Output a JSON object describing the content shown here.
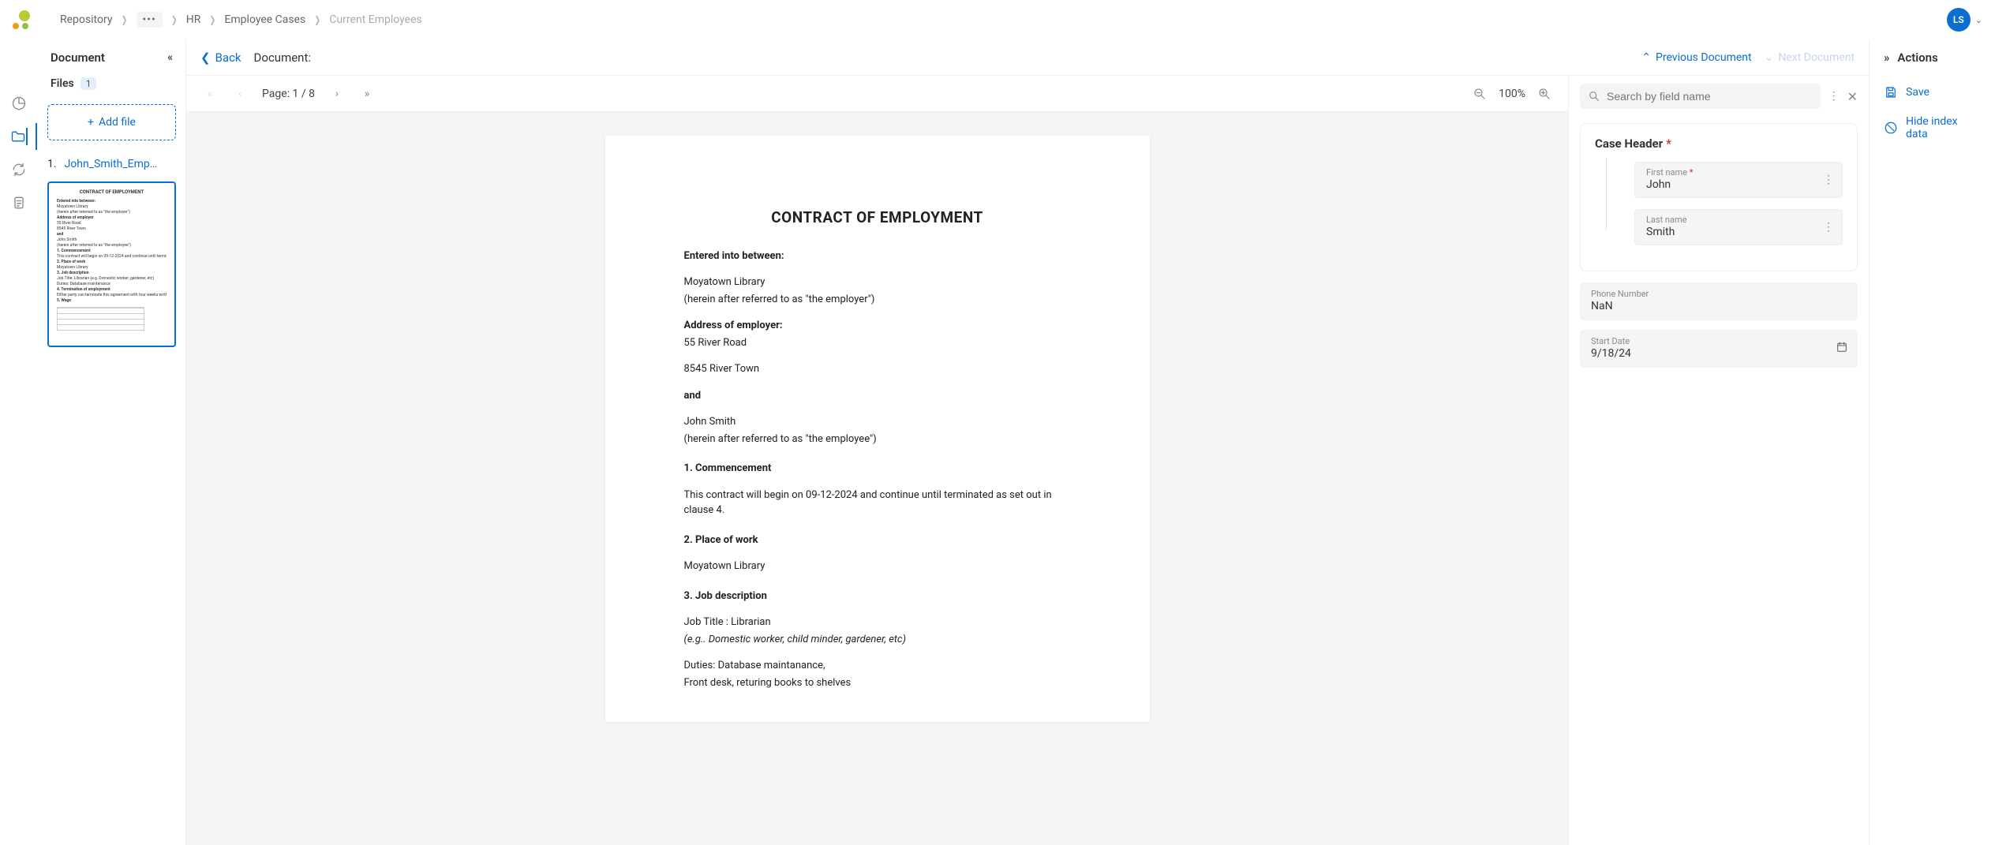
{
  "breadcrumb": {
    "root": "Repository",
    "ellipsis": "•••",
    "hr": "HR",
    "cases": "Employee Cases",
    "current": "Current Employees"
  },
  "user": {
    "initials": "LS"
  },
  "sidebar": {
    "title": "Document",
    "files_label": "Files",
    "files_count": "1",
    "add_file": "Add file",
    "file": {
      "index": "1.",
      "name": "John_Smith_Emp…"
    }
  },
  "docHeader": {
    "back": "Back",
    "label": "Document:",
    "prev": "Previous Document",
    "next": "Next Document"
  },
  "viewerToolbar": {
    "page_label": "Page: 1 / 8",
    "zoom": "100%"
  },
  "page": {
    "title": "CONTRACT OF EMPLOYMENT",
    "entered": "Entered into between:",
    "employer_name": "Moyatown Library",
    "employer_ref": "(herein after referred to as \"the employer\")",
    "addr_label": "Address of employer:",
    "addr1": "55 River Road",
    "addr2": "8545 River Town",
    "and": "and",
    "employee_name": "John Smith",
    "employee_ref": "(herein after referred to as \"the employee\")",
    "s1": "1. Commencement",
    "s1_body": "This contract will begin on 09-12-2024 and continue until terminated as set out in clause 4.",
    "s2": "2. Place of work",
    "s2_body": "Moyatown Library",
    "s3": "3. Job description",
    "s3_title": "Job Title : Librarian",
    "s3_eg": "(e.g.. Domestic worker, child minder, gardener, etc)",
    "s3_duties1": "Duties: Database maintanance,",
    "s3_duties2": "Front desk, returing books to shelves"
  },
  "thumb": {
    "title": "CONTRACT OF EMPLOYMENT"
  },
  "index": {
    "search_placeholder": "Search by field name",
    "header": "Case Header",
    "first_name_label": "First name",
    "first_name_value": "John",
    "last_name_label": "Last name",
    "last_name_value": "Smith",
    "phone_label": "Phone Number",
    "phone_value": "NaN",
    "start_label": "Start Date",
    "start_value": "9/18/24"
  },
  "actions": {
    "title": "Actions",
    "save": "Save",
    "hide": "Hide index data"
  }
}
